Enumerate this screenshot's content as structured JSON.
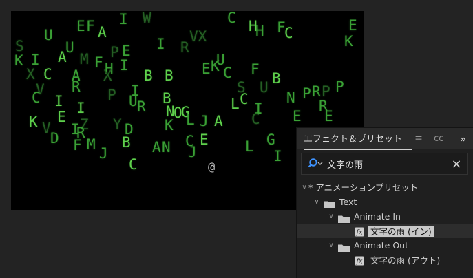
{
  "viewer": {
    "glyph_color": "#5fd04c",
    "glyphs": [
      {
        "text": "E",
        "cls": "mid"
      },
      {
        "text": "F",
        "cls": "mid"
      },
      {
        "text": "A",
        "cls": ""
      },
      {
        "text": "I",
        "cls": "mid"
      },
      {
        "text": "W",
        "cls": "dim"
      },
      {
        "text": "U",
        "cls": "mid"
      },
      {
        "text": "S",
        "cls": "dim"
      },
      {
        "text": "P",
        "cls": "dim"
      },
      {
        "text": "E",
        "cls": "mid"
      },
      {
        "text": "U",
        "cls": "mid"
      },
      {
        "text": "I",
        "cls": "mid"
      },
      {
        "text": "R",
        "cls": "dim"
      },
      {
        "text": "VX",
        "cls": "dim"
      },
      {
        "text": "H",
        "cls": ""
      },
      {
        "text": "H",
        "cls": "mid"
      },
      {
        "text": "F",
        "cls": "mid"
      },
      {
        "text": "C",
        "cls": ""
      },
      {
        "text": "C",
        "cls": "mid"
      },
      {
        "text": "E",
        "cls": "mid"
      },
      {
        "text": "K",
        "cls": "mid"
      },
      {
        "text": "A",
        "cls": ""
      },
      {
        "text": "K",
        "cls": "mid"
      },
      {
        "text": "M",
        "cls": "dim"
      },
      {
        "text": "F",
        "cls": "mid"
      },
      {
        "text": "H",
        "cls": "mid"
      },
      {
        "text": "I",
        "cls": "mid"
      },
      {
        "text": "I",
        "cls": "mid"
      },
      {
        "text": "U",
        "cls": "mid"
      },
      {
        "text": "E",
        "cls": "mid"
      },
      {
        "text": "K",
        "cls": "mid"
      },
      {
        "text": "X",
        "cls": "dim"
      },
      {
        "text": "C",
        "cls": ""
      },
      {
        "text": "A",
        "cls": "mid"
      },
      {
        "text": "X",
        "cls": "dim"
      },
      {
        "text": "B",
        "cls": ""
      },
      {
        "text": "B",
        "cls": ""
      },
      {
        "text": "C",
        "cls": "mid"
      },
      {
        "text": "F",
        "cls": "mid"
      },
      {
        "text": "B",
        "cls": ""
      },
      {
        "text": "R",
        "cls": "mid"
      },
      {
        "text": "P",
        "cls": "mid"
      },
      {
        "text": "V",
        "cls": "dim"
      },
      {
        "text": "P",
        "cls": "dim"
      },
      {
        "text": "I",
        "cls": "mid"
      },
      {
        "text": "S",
        "cls": "dim"
      },
      {
        "text": "U",
        "cls": "dim"
      },
      {
        "text": "R",
        "cls": "mid"
      },
      {
        "text": "P",
        "cls": "dim"
      },
      {
        "text": "C",
        "cls": "mid"
      },
      {
        "text": "I",
        "cls": ""
      },
      {
        "text": "U",
        "cls": "mid"
      },
      {
        "text": "R",
        "cls": "mid"
      },
      {
        "text": "B",
        "cls": ""
      },
      {
        "text": "L",
        "cls": ""
      },
      {
        "text": "C",
        "cls": ""
      },
      {
        "text": "I",
        "cls": "mid"
      },
      {
        "text": "N",
        "cls": "mid"
      },
      {
        "text": "P",
        "cls": "mid"
      },
      {
        "text": "R",
        "cls": "mid"
      },
      {
        "text": "E",
        "cls": "mid"
      },
      {
        "text": "N",
        "cls": ""
      },
      {
        "text": "O",
        "cls": ""
      },
      {
        "text": "G",
        "cls": ""
      },
      {
        "text": "L",
        "cls": "mid"
      },
      {
        "text": "K",
        "cls": ""
      },
      {
        "text": "E",
        "cls": ""
      },
      {
        "text": "I",
        "cls": ""
      },
      {
        "text": "Z",
        "cls": "dim"
      },
      {
        "text": "Y",
        "cls": "dim"
      },
      {
        "text": "K",
        "cls": "mid"
      },
      {
        "text": "J",
        "cls": "mid"
      },
      {
        "text": "A",
        "cls": ""
      },
      {
        "text": "C",
        "cls": "dim"
      },
      {
        "text": "E",
        "cls": "mid"
      },
      {
        "text": "V",
        "cls": "dim"
      },
      {
        "text": "D",
        "cls": "mid"
      },
      {
        "text": "I",
        "cls": "mid"
      },
      {
        "text": "R",
        "cls": "mid"
      },
      {
        "text": "D",
        "cls": "mid"
      },
      {
        "text": "F",
        "cls": "mid"
      },
      {
        "text": "M",
        "cls": "mid"
      },
      {
        "text": "J",
        "cls": "mid"
      },
      {
        "text": "B",
        "cls": ""
      },
      {
        "text": "A",
        "cls": "mid"
      },
      {
        "text": "N",
        "cls": "mid"
      },
      {
        "text": "C",
        "cls": "mid"
      },
      {
        "text": "E",
        "cls": ""
      },
      {
        "text": "J",
        "cls": "mid"
      },
      {
        "text": "L",
        "cls": "mid"
      },
      {
        "text": "G",
        "cls": "mid"
      },
      {
        "text": "I",
        "cls": "mid"
      },
      {
        "text": "C",
        "cls": ""
      },
      {
        "text": "@",
        "cls": "white"
      }
    ]
  },
  "effects_panel": {
    "tab_title": "エフェクト＆プリセット",
    "menu_glyph": "≡",
    "next_tab": "cc",
    "expand_glyph": "»",
    "search": {
      "value": "文字の雨",
      "placeholder": ""
    },
    "clear_glyph": "×",
    "tree": {
      "root_label": "* アニメーションプリセット",
      "text_folder": "Text",
      "animate_in_folder": "Animate In",
      "preset_in": "文字の雨 (イン)",
      "animate_out_folder": "Animate Out",
      "preset_out": "文字の雨 (アウト)"
    },
    "twisty_open": "∨"
  },
  "colors": {
    "panel_bg": "#1f1f1f",
    "app_bg": "#232323",
    "highlight_bg": "#c8c8c8",
    "annotation_red": "#ff1f1f"
  }
}
